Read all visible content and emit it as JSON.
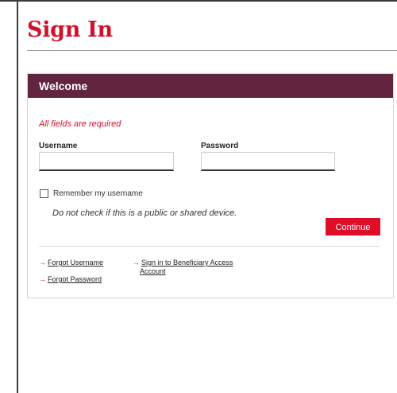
{
  "page": {
    "title": "Sign In"
  },
  "card": {
    "header": "Welcome",
    "required_note": "All fields are required",
    "username_label": "Username",
    "username_value": "",
    "password_label": "Password",
    "password_value": "",
    "remember_label": "Remember my username",
    "remember_checked": false,
    "warning": "Do not check if this is a public or shared device.",
    "continue_label": "Continue"
  },
  "links": {
    "arrow": "→",
    "forgot_username": "Forgot Username",
    "forgot_password": "Forgot Password",
    "beneficiary_line1": "Sign in to Beneficiary Access",
    "beneficiary_line2": "Account"
  },
  "colors": {
    "title_red": "#d0112b",
    "header_plum": "#632440",
    "button_red": "#e00d28"
  }
}
